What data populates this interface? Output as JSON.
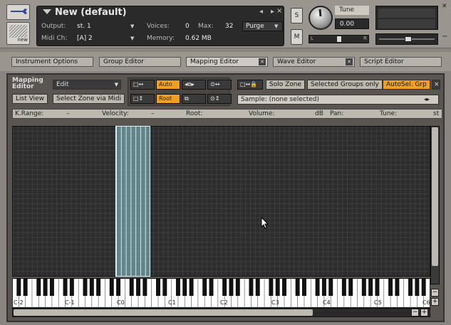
{
  "instrument": {
    "title": "New (default)",
    "output_label": "Output:",
    "output_value": "st. 1",
    "midi_label": "Midi Ch:",
    "midi_value": "[A]  2",
    "voices_label": "Voices:",
    "voices_value": "0",
    "max_label": "Max:",
    "max_value": "32",
    "memory_label": "Memory:",
    "memory_value": "0.62 MB",
    "purge_label": "Purge",
    "new_label": "new",
    "solo_label": "S",
    "mute_label": "M",
    "tune_label": "Tune",
    "tune_value": "0.00",
    "pan_left": "L",
    "pan_right": "R"
  },
  "tabs": [
    {
      "label": "Instrument Options"
    },
    {
      "label": "Group Editor"
    },
    {
      "label": "Mapping Editor"
    },
    {
      "label": "Wave Editor"
    },
    {
      "label": "Script Editor"
    }
  ],
  "mapping": {
    "title_line1": "Mapping",
    "title_line2": "Editor",
    "mode_value": "Edit",
    "list_view": "List View",
    "select_zone": "Select Zone via Midi",
    "auto_label": "Auto",
    "root_label": "Root",
    "solo_zone": "Solo Zone",
    "selected_groups_only": "Selected Groups only",
    "autosel_grp": "AutoSel. Grp",
    "sample_label": "Sample:",
    "sample_value": "(none selected)",
    "close_label": "×",
    "info": {
      "krange_label": "K.Range:",
      "krange_value": "–",
      "velocity_label": "Velocity:",
      "velocity_value": "–",
      "root_label": "Root:",
      "volume_label": "Volume:",
      "volume_unit": "dB",
      "pan_label": "Pan:",
      "tune_label": "Tune:",
      "tune_unit": "st"
    },
    "octaves": [
      "C-2",
      "C-1",
      "C0",
      "C1",
      "C2",
      "C3",
      "C4",
      "C5",
      "C6"
    ],
    "scroll_minus": "−",
    "scroll_plus": "+"
  },
  "colors": {
    "accent_orange": "#f0a020",
    "zone_fill": "#8cc8d2",
    "grid_bg": "#2c2c2c"
  }
}
